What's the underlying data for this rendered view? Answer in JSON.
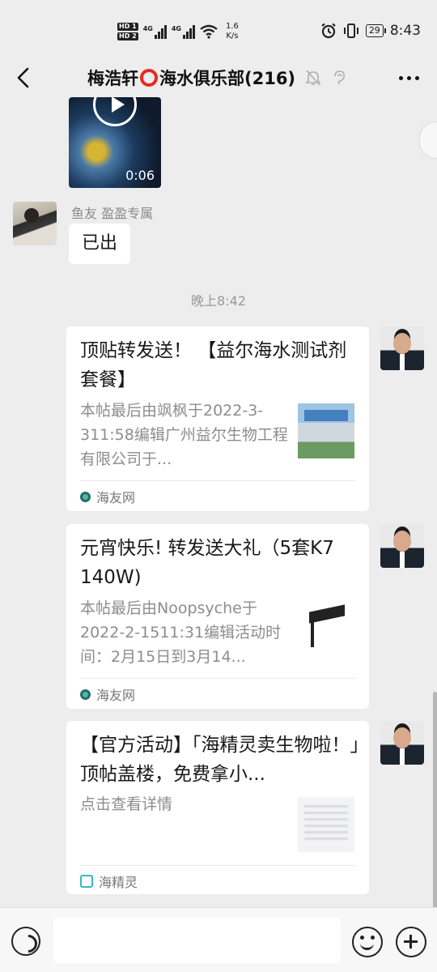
{
  "status_bar": {
    "hd1": "HD 1",
    "hd2": "HD 2",
    "net1": "4G",
    "net2": "4G",
    "speed_value": "1.6",
    "speed_unit": "K/s",
    "battery": "29",
    "time": "8:43"
  },
  "header": {
    "title_part1": "梅浩轩",
    "title_part2": "海水俱乐部(216)"
  },
  "messages": {
    "video": {
      "duration": "0:06"
    },
    "friend": {
      "sender": "鱼友 盈盈专属",
      "text": "已出"
    },
    "timestamp": "晚上8:42",
    "cards": [
      {
        "title": "顶贴转发送！ 【益尔海水测试剂套餐】",
        "desc": "本帖最后由飒枫于2022-3-311:58编辑广州益尔生物工程有限公司于...",
        "source": "海友网",
        "source_icon": "haiyou-logo-icon"
      },
      {
        "title": "元宵快乐! 转发送大礼（5套K7 140W)",
        "desc": "本帖最后由Noopsyche于2022-2-1511:31编辑活动时间：2月15日到3月14...",
        "source": "海友网",
        "source_icon": "haiyou-logo-icon"
      },
      {
        "title": "【官方活动】「海精灵卖生物啦！」顶帖盖楼，免费拿小...",
        "desc": "点击查看详情",
        "source": "海精灵",
        "source_icon": "haijingling-logo-icon"
      }
    ]
  },
  "colors": {
    "background": "#ededed",
    "bubble": "#ffffff",
    "accent_ring": "#e52b1f",
    "secondary_text": "#8d8d8d"
  }
}
